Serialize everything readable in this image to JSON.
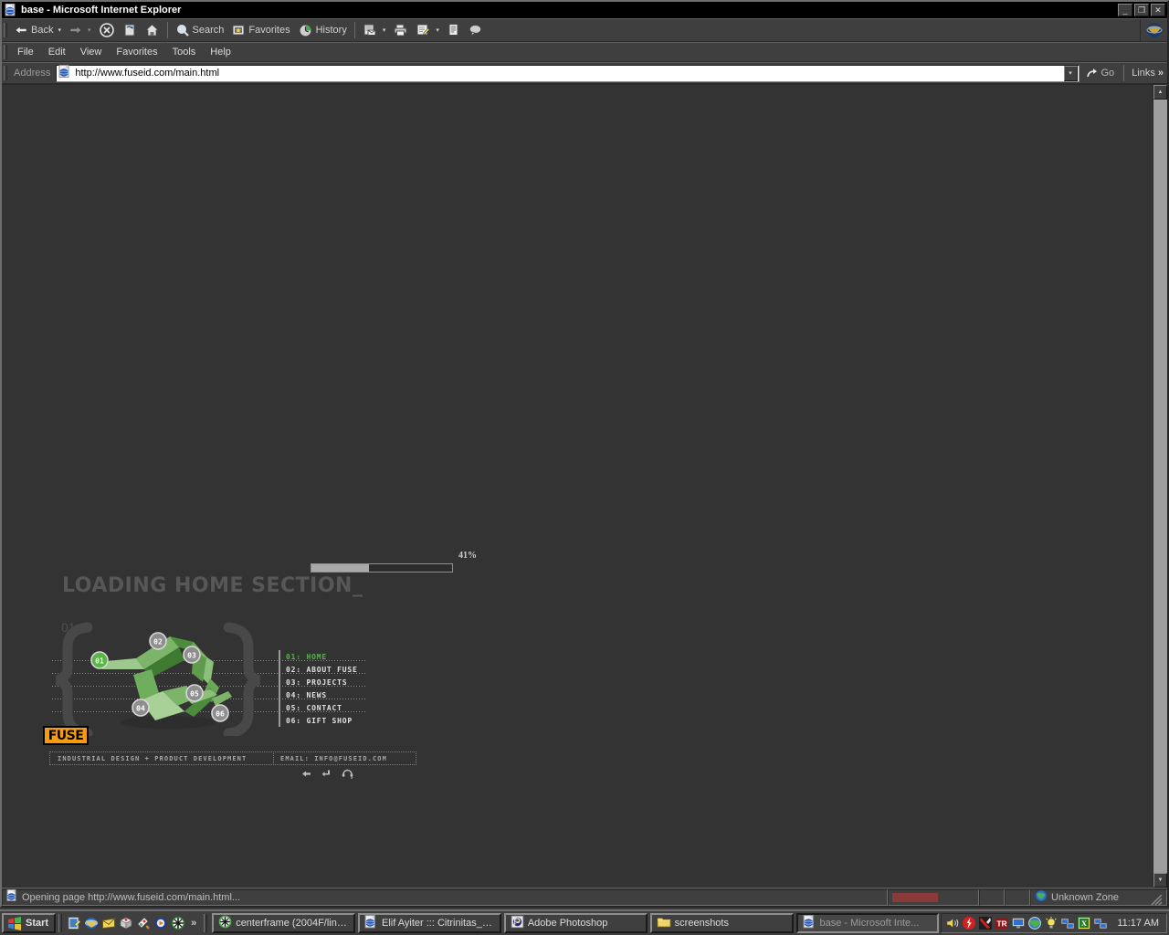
{
  "window": {
    "title": "base - Microsoft Internet Explorer",
    "icon": "ie-document-icon",
    "minimize_label": "_",
    "maximize_label": "❐",
    "close_label": "✕"
  },
  "toolbar": {
    "back_label": "Back",
    "forward_label": "",
    "stop_label": "",
    "refresh_label": "",
    "home_label": "",
    "search_label": "Search",
    "favorites_label": "Favorites",
    "history_label": "History",
    "mail_label": "",
    "print_label": "",
    "edit_label": "",
    "discuss_label": "",
    "messenger_label": ""
  },
  "menu": {
    "items": [
      "File",
      "Edit",
      "View",
      "Favorites",
      "Tools",
      "Help"
    ]
  },
  "address": {
    "label": "Address",
    "url": "http://www.fuseid.com/main.html",
    "go_label": "Go",
    "links_label": "Links",
    "links_chevron": "»",
    "dropdown_caret": "▾"
  },
  "page": {
    "background": "#333333",
    "progress": {
      "percent_label": "41%",
      "percent_value": 41
    },
    "loading_title": "LOADING HOME SECTION_",
    "section_number": "01",
    "accent_green": "#56b34a",
    "logo": {
      "text": "FUSE",
      "background": "#f79a0e"
    },
    "nav": [
      {
        "label": "01: HOME",
        "active": true
      },
      {
        "label": "02: ABOUT FUSE",
        "active": false
      },
      {
        "label": "03: PROJECTS",
        "active": false
      },
      {
        "label": "04: NEWS",
        "active": false
      },
      {
        "label": "05: CONTACT",
        "active": false
      },
      {
        "label": "06: GIFT SHOP",
        "active": false
      }
    ],
    "node_labels": [
      "01",
      "02",
      "03",
      "04",
      "05",
      "06"
    ],
    "footer": {
      "tagline": "INDUSTRIAL DESIGN + PRODUCT DEVELOPMENT",
      "email": "EMAIL: INFO@FUSEID.COM"
    },
    "mini_icons": [
      "back-arrow-icon",
      "enter-arrow-icon",
      "headphones-icon"
    ]
  },
  "statusbar": {
    "message": "Opening page http://www.fuseid.com/main.html...",
    "zone": "Unknown Zone",
    "zone_icon": "globe-icon"
  },
  "taskbar": {
    "start_label": "Start",
    "quicklaunch": [
      "show-desktop-icon",
      "internet-explorer-icon",
      "outlook-express-icon",
      "media-box-icon",
      "paint-icon",
      "media-player-icon",
      "flash-icon"
    ],
    "quicklaunch_more": "»",
    "tasks": [
      {
        "label": "centerframe (2004F/link...",
        "icon": "flash-icon",
        "active": false
      },
      {
        "label": "Elif Ayiter ::: Citrinitas__...",
        "icon": "ie-document-icon",
        "active": false
      },
      {
        "label": "Adobe Photoshop",
        "icon": "photoshop-icon",
        "active": false
      },
      {
        "label": "screenshots",
        "icon": "folder-icon",
        "active": false
      },
      {
        "label": "base - Microsoft Inte...",
        "icon": "ie-document-icon",
        "active": true
      }
    ],
    "tray": [
      "volume-icon",
      "antivirus-icon",
      "nod32-icon",
      "language-tr-icon",
      "monitor-icon",
      "globe-icon",
      "lightbulb-icon",
      "network-icon",
      "excel-icon",
      "network2-icon"
    ],
    "language_label": "TR",
    "clock": "11:17 AM"
  }
}
